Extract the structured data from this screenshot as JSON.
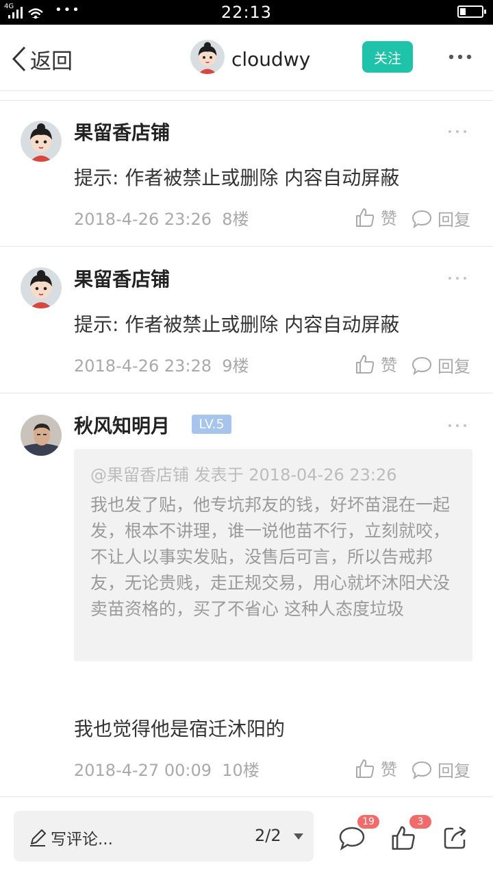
{
  "status_bar": {
    "network": "4G",
    "time": "22:13",
    "more": "•••"
  },
  "header": {
    "back_label": "返回",
    "username": "cloudwy",
    "follow_label": "关注"
  },
  "posts": [
    {
      "author": "果留香店铺",
      "content": "提示: 作者被禁止或删除 内容自动屏蔽",
      "date": "2018-4-26 23:26",
      "floor": "8楼",
      "like_label": "赞",
      "reply_label": "回复"
    },
    {
      "author": "果留香店铺",
      "content": "提示: 作者被禁止或删除 内容自动屏蔽",
      "date": "2018-4-26 23:28",
      "floor": "9楼",
      "like_label": "赞",
      "reply_label": "回复"
    },
    {
      "author": "秋风知明月",
      "level": "LV.5",
      "quote_header": "@果留香店铺 发表于 2018-04-26 23:26",
      "quote_body": "我也发了贴，他专坑邦友的钱，好坏苗混在一起发，根本不讲理，谁一说他苗不行，立刻就咬，不让人以事实发贴，没售后可言，所以告戒邦友，无论贵贱，走正规交易，用心就坏沐阳犬没卖苗资格的，买了不省心 这种人态度垃圾",
      "content": "我也觉得他是宿迁沐阳的",
      "date": "2018-4-27 00:09",
      "floor": "10楼",
      "like_label": "赞",
      "reply_label": "回复"
    }
  ],
  "bottom_bar": {
    "comment_placeholder": "写评论...",
    "page": "2/2",
    "comment_count": "19",
    "like_count": "3"
  },
  "colors": {
    "accent": "#1fc3aa",
    "badge": "#f26b6b",
    "level_badge": "#a6c4ec",
    "meta_text": "#a9a9a9"
  }
}
